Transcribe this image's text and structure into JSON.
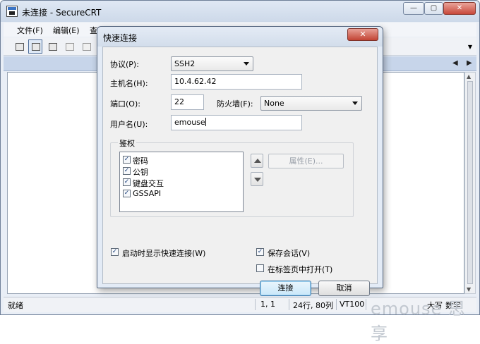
{
  "app": {
    "title": "未连接 - SecureCRT",
    "window_buttons": [
      "—",
      "▢",
      "✕"
    ]
  },
  "menu": [
    "文件(F)",
    "编辑(E)",
    "查看"
  ],
  "tab_arrows": [
    "◀",
    "▶"
  ],
  "status": {
    "ready": "就绪",
    "cursor": "1,  1",
    "size": "24行, 80列",
    "terminal": "VT100",
    "caps": "大写",
    "num": "数字"
  },
  "watermark": "emouse 思 享",
  "dialog": {
    "title": "快速连接",
    "close_glyph": "✕",
    "protocol_label": "协议(P):",
    "protocol_value": "SSH2",
    "hostname_label": "主机名(H):",
    "hostname_value": "10.4.62.42",
    "port_label": "端口(O):",
    "port_value": "22",
    "firewall_label": "防火墙(F):",
    "firewall_value": "None",
    "username_label": "用户名(U):",
    "username_value": "emouse",
    "auth_group_title": "鉴权",
    "auth_methods": [
      {
        "label": "密码",
        "checked": true
      },
      {
        "label": "公钥",
        "checked": true
      },
      {
        "label": "键盘交互",
        "checked": true
      },
      {
        "label": "GSSAPI",
        "checked": true
      }
    ],
    "properties_button": "属性(E)...",
    "show_on_startup": {
      "label": "启动时显示快速连接(W)",
      "checked": true
    },
    "save_session": {
      "label": "保存会话(V)",
      "checked": true
    },
    "open_in_tab": {
      "label": "在标签页中打开(T)",
      "checked": false
    },
    "connect_button": "连接",
    "cancel_button": "取消"
  }
}
